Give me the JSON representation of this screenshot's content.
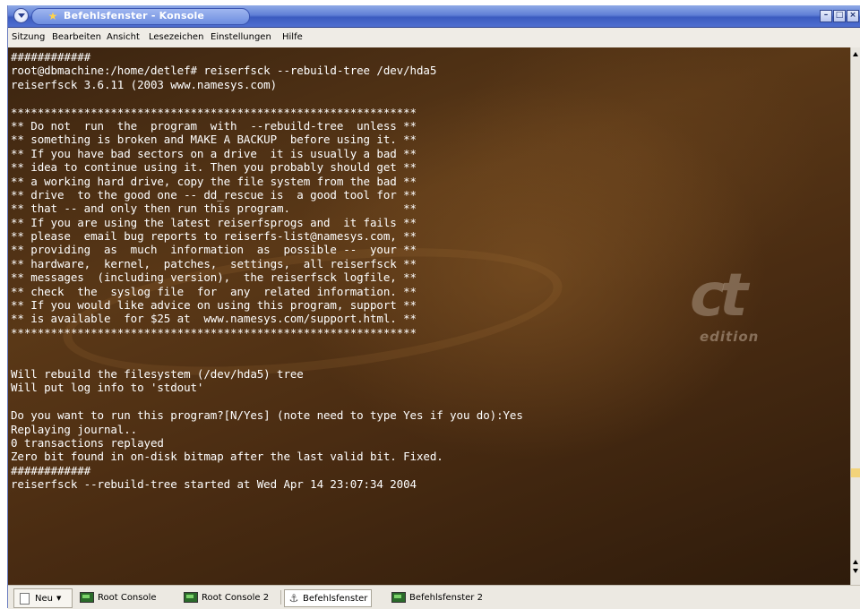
{
  "window": {
    "title": "Befehlsfenster - Konsole",
    "controls": [
      "minimize",
      "maximize",
      "close"
    ]
  },
  "menubar": {
    "items": [
      "Sitzung",
      "Bearbeiten",
      "Ansicht",
      "Lesezeichen",
      "Einstellungen",
      "Hilfe"
    ]
  },
  "terminal": {
    "background_logo": {
      "text": "ct",
      "subtext": "edition"
    },
    "lines": [
      "############",
      "root@dbmachine:/home/detlef# reiserfsck --rebuild-tree /dev/hda5",
      "reiserfsck 3.6.11 (2003 www.namesys.com)",
      "",
      "*************************************************************",
      "** Do not  run  the  program  with  --rebuild-tree  unless **",
      "** something is broken and MAKE A BACKUP  before using it. **",
      "** If you have bad sectors on a drive  it is usually a bad **",
      "** idea to continue using it. Then you probably should get **",
      "** a working hard drive, copy the file system from the bad **",
      "** drive  to the good one -- dd_rescue is  a good tool for **",
      "** that -- and only then run this program.                 **",
      "** If you are using the latest reiserfsprogs and  it fails **",
      "** please  email bug reports to reiserfs-list@namesys.com, **",
      "** providing  as  much  information  as  possible --  your **",
      "** hardware,  kernel,  patches,  settings,  all reiserfsck **",
      "** messages  (including version),  the reiserfsck logfile, **",
      "** check  the  syslog file  for  any  related information. **",
      "** If you would like advice on using this program, support **",
      "** is available  for $25 at  www.namesys.com/support.html. **",
      "*************************************************************",
      "",
      "",
      "Will rebuild the filesystem (/dev/hda5) tree",
      "Will put log info to 'stdout'",
      "",
      "Do you want to run this program?[N/Yes] (note need to type Yes if you do):Yes",
      "Replaying journal..",
      "0 transactions replayed",
      "Zero bit found in on-disk bitmap after the last valid bit. Fixed.",
      "############",
      "reiserfsck --rebuild-tree started at Wed Apr 14 23:07:34 2004"
    ]
  },
  "taskbar": {
    "new_label": "Neu",
    "sessions": [
      "Root Console",
      "Root Console 2",
      "Befehlsfenster",
      "Befehlsfenster 2"
    ],
    "active_session": "Befehlsfenster"
  },
  "colors": {
    "titlebar": "#4f6fd0",
    "terminal_bg": "#4a2c12",
    "terminal_text": "#ffffff"
  }
}
